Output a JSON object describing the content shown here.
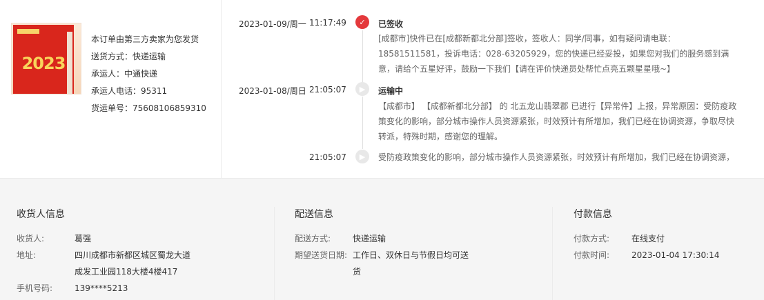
{
  "shipping": {
    "lines": [
      "本订单由第三方卖家为您发货",
      "送货方式：快递运输",
      "承运人：中通快递",
      "承运人电话：95311",
      "货运单号：75608106859310"
    ]
  },
  "timeline": [
    {
      "date": "2023-01-09/周一",
      "time": "11:17:49",
      "status": "已签收",
      "desc": "[成都市]快件已在[成都新都北分部]签收，签收人：同学/同事，如有疑问请电联：18581511581，投诉电话：028-63205929，您的快递已经妥投，如果您对我们的服务感到满意，请给个五星好评，鼓励一下我们【请在评价快递员处帮忙点亮五颗星星哦~】",
      "icon": "check-icon",
      "color": "#e4393c"
    },
    {
      "date": "2023-01-08/周日",
      "time": "21:05:07",
      "status": "运输中",
      "desc": "【成都市】 【成都新都北分部】 的 北五龙山翡翠郡 已进行【异常件】上报，异常原因：受防疫政策变化的影响，部分城市操作人员资源紧张，时效预计有所增加，我们已经在协调资源，争取尽快转派，特殊时期，感谢您的理解。",
      "icon": "truck-icon",
      "color": "#e8e8e8"
    },
    {
      "date": "",
      "time": "21:05:07",
      "status": "",
      "desc": "受防疫政策变化的影响，部分城市操作人员资源紧张，时效预计有所增加，我们已经在协调资源，",
      "icon": "truck-icon",
      "color": "#e8e8e8"
    }
  ],
  "receiver": {
    "title": "收货人信息",
    "name_label": "收货人:",
    "name": "葛强",
    "address_label": "地址:",
    "address_line1": "四川成都市新都区城区蜀龙大道",
    "address_line2": "成发工业园118大楼4楼417",
    "phone_label": "手机号码:",
    "phone": "139****5213"
  },
  "delivery": {
    "title": "配送信息",
    "method_label": "配送方式:",
    "method": "快递运输",
    "date_label": "期望送货日期:",
    "date_line1": "工作日、双休日与节假日均可送",
    "date_line2": "货"
  },
  "payment": {
    "title": "付款信息",
    "method_label": "付款方式:",
    "method": "在线支付",
    "time_label": "付款时间:",
    "time": "2023-01-04 17:30:14"
  }
}
